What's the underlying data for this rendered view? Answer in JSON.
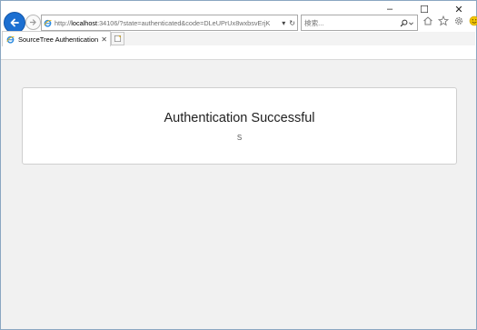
{
  "window": {
    "minimize": "–",
    "maximize": "☐",
    "close": "✕"
  },
  "address_bar": {
    "protocol": "http://",
    "host": "localhost",
    "path": ":34106/?state=authenticated&code=DLeUPrUx8wxbsvErjK",
    "dropdown": "▾",
    "refresh": "↻"
  },
  "search": {
    "placeholder": "検索...",
    "value": ""
  },
  "tabs": [
    {
      "label": "SourceTree Authentication",
      "close": "✕"
    }
  ],
  "page": {
    "heading": "Authentication Successful",
    "subtext": "S"
  },
  "icons": {
    "back": "back-arrow-icon",
    "forward": "forward-arrow-icon",
    "ie": "internet-explorer-icon",
    "search": "search-icon",
    "home": "home-icon",
    "favorites": "star-icon",
    "settings": "gear-icon",
    "feedback": "smiley-icon",
    "new_tab": "new-tab-icon"
  },
  "colors": {
    "accent": "#1c6fd1",
    "feedback": "#f2c500"
  }
}
